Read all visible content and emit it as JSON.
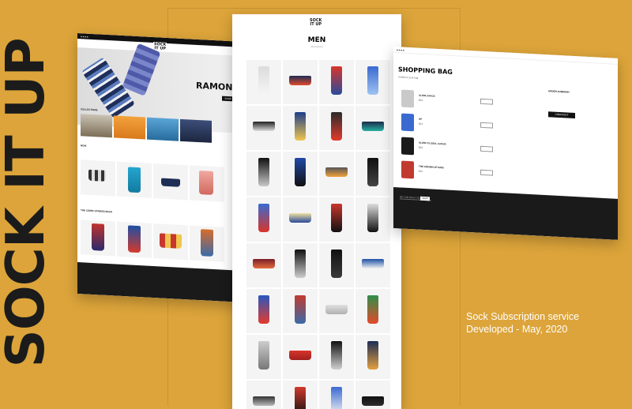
{
  "brand": {
    "name": "SOCK IT UP"
  },
  "caption": {
    "line1": "Sock Subscription service",
    "line2": "Developed - May, 2020"
  },
  "left_panel": {
    "logo_line1": "SOCK",
    "logo_line2": "IT UP",
    "hero_title": "RAMONES",
    "hero_button": "SHOP THE COLLAB",
    "collections_title": "COLLECTIONS",
    "now_trending_title": "NOW",
    "comics_title": "THE COMIC STRIKES BACK"
  },
  "men_panel": {
    "title": "MEN",
    "subtitle": "40 products"
  },
  "bag_panel": {
    "title": "SHOPPING BAG",
    "subtitle": "4 items in your bag",
    "summary_title": "ORDER SUMMARY",
    "checkout_button": "CHECKOUT",
    "items": [
      {
        "name": "ALIEN 3-PACK",
        "price": "$34"
      },
      {
        "name": "UP",
        "price": "$14"
      },
      {
        "name": "ALIEN TO SOUL 3-PACK",
        "price": "$34"
      },
      {
        "name": "THE CROWN OF KING",
        "price": "$16"
      }
    ],
    "newsletter_placeholder": "BE THE FIRST TO KNOW",
    "newsletter_button": "SIGN UP"
  },
  "colors": {
    "background": "#dca43a",
    "dark": "#1a1a1a",
    "caption": "#ffffff"
  }
}
